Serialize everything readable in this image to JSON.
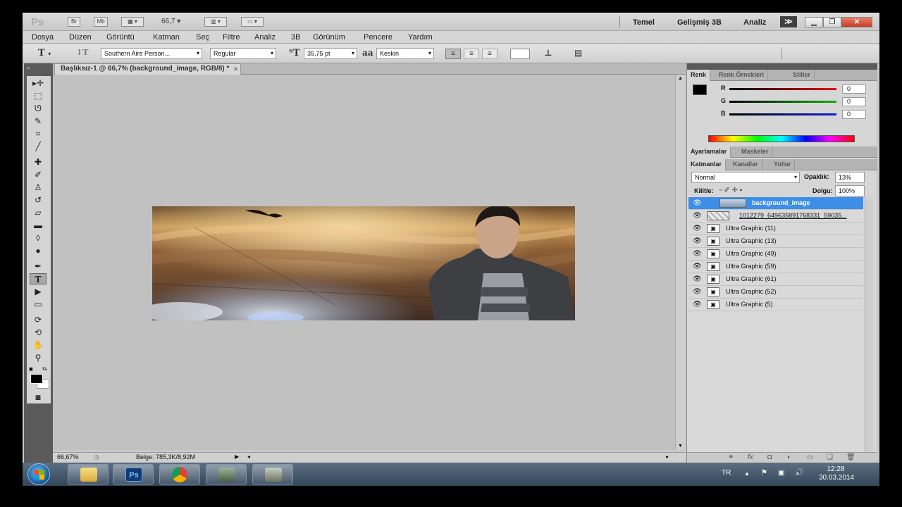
{
  "appbar": {
    "logo": "Ps",
    "btn_br": "Br",
    "btn_mb": "Mb",
    "zoom": "66,7",
    "workspaces": [
      "Temel",
      "Gelişmiş 3B",
      "Analiz"
    ],
    "more": "≫"
  },
  "menu": [
    "Dosya",
    "Düzen",
    "Görüntü",
    "Katman",
    "Seç",
    "Filtre",
    "Analiz",
    "3B",
    "Görünüm",
    "Pencere",
    "Yardım"
  ],
  "options": {
    "font_family": "Southern Aire Person...",
    "font_style": "Regular",
    "font_size": "35,75 pt",
    "aa_label": "aa",
    "antialias": "Keskin"
  },
  "document": {
    "tab_title": "Başlıksız-1 @ 66,7% (background_image, RGB/8) *",
    "zoom": "66,67%",
    "doc_info": "Belge: 785,3K/8,92M"
  },
  "color_panel": {
    "tabs": [
      "Renk",
      "Renk Örnekleri",
      "Stiller"
    ],
    "channels": [
      {
        "label": "R",
        "value": "0",
        "color": "#e01010"
      },
      {
        "label": "G",
        "value": "0",
        "color": "#10b010"
      },
      {
        "label": "B",
        "value": "0",
        "color": "#1020d0"
      }
    ]
  },
  "adjust_panel": {
    "tabs": [
      "Ayarlamalar",
      "Maskeler"
    ]
  },
  "layers_panel": {
    "tabs": [
      "Katmanlar",
      "Kanallar",
      "Yollar"
    ],
    "blend_mode": "Normal",
    "opacity_label": "Opaklık:",
    "opacity": "13%",
    "lock_label": "Kilitle:",
    "fill_label": "Dolgu:",
    "fill": "100%",
    "layers": [
      {
        "name": "background_image",
        "selected": true
      },
      {
        "name": "1012279_649635891768331_59035...",
        "selected": false
      },
      {
        "name": "Ultra Graphic (11)",
        "selected": false
      },
      {
        "name": "Ultra Graphic (13)",
        "selected": false
      },
      {
        "name": "Ultra Graphic (49)",
        "selected": false
      },
      {
        "name": "Ultra Graphic (59)",
        "selected": false
      },
      {
        "name": "Ultra Graphic (61)",
        "selected": false
      },
      {
        "name": "Ultra Graphic (52)",
        "selected": false
      },
      {
        "name": "Ultra Graphic (5)",
        "selected": false
      }
    ]
  },
  "taskbar": {
    "apps": [
      "explorer-icon",
      "photoshop-icon",
      "chrome-icon",
      "app-icon",
      "app-icon-2"
    ],
    "ps_label": "Ps",
    "lang": "TR",
    "time": "12:28",
    "date": "30.03.2014"
  }
}
